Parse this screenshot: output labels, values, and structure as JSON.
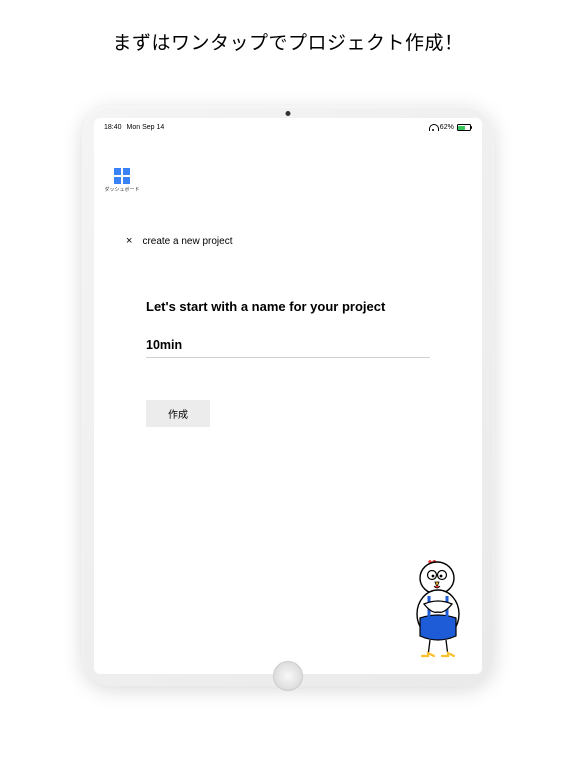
{
  "promo": {
    "headline": "まずはワンタップでプロジェクト作成！"
  },
  "status": {
    "time": "18:40",
    "date": "Mon Sep 14",
    "battery_pct": "62%"
  },
  "sidebar": {
    "dashboard_label": "ダッシュボード"
  },
  "modal": {
    "title": "create a new project",
    "heading": "Let's start with a name for your project",
    "input_value": "10min",
    "create_label": "作成"
  },
  "icons": {
    "close": "×"
  }
}
